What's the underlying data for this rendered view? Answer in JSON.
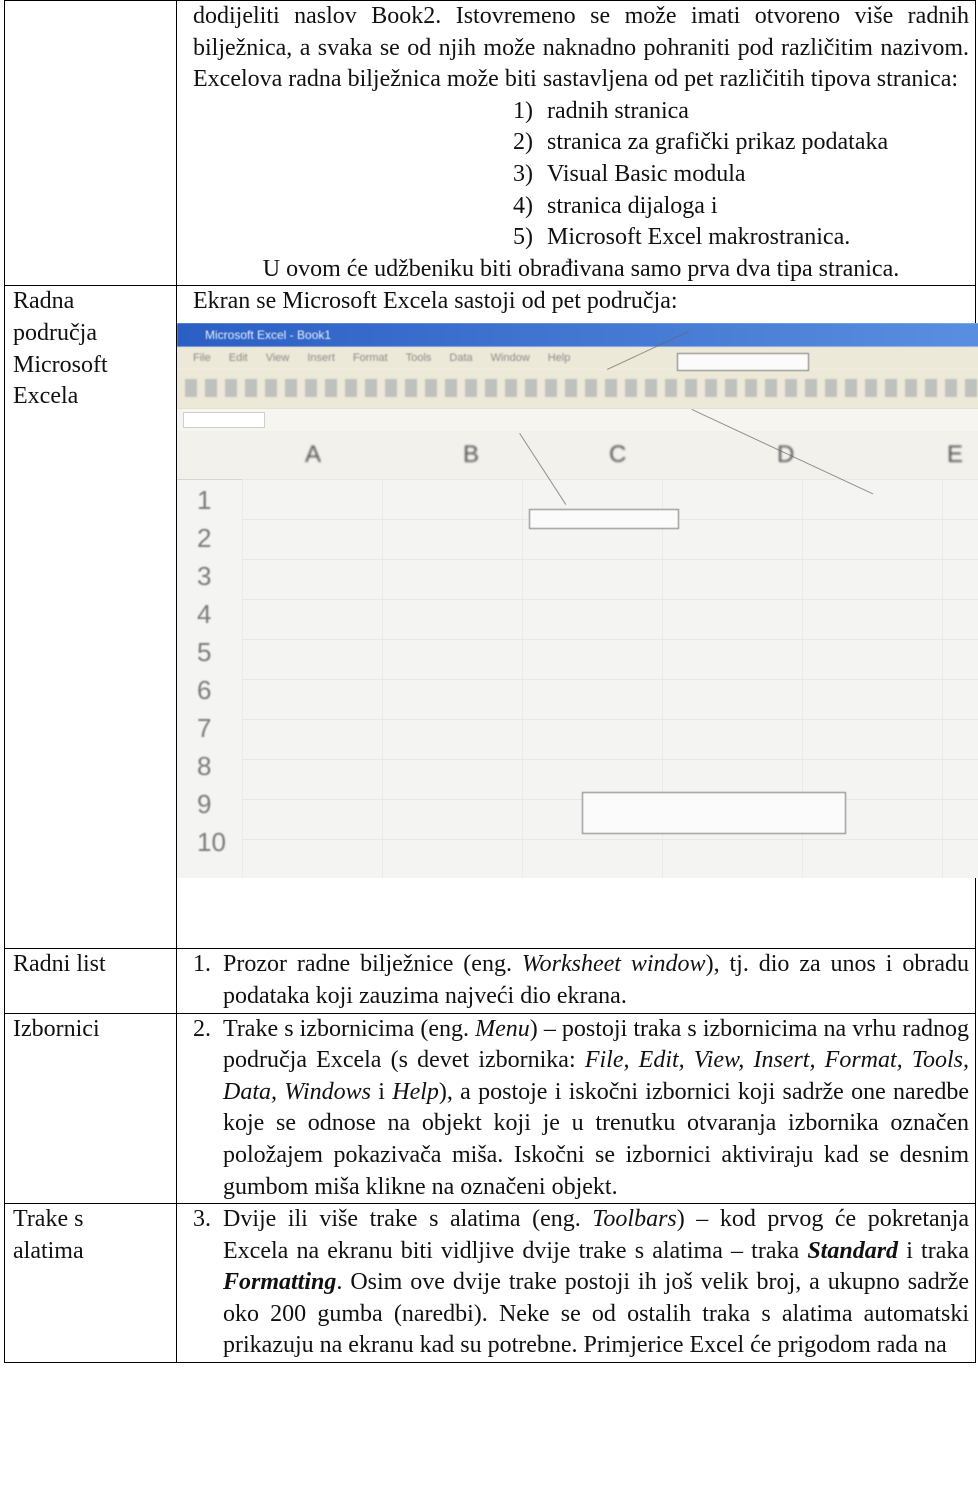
{
  "intro": {
    "paragraph": "dodijeliti naslov Book2. Istovremeno se može imati otvoreno više radnih bilježnica, a svaka se od njih može naknadno pohraniti pod različitim nazivom. Excelova radna bilježnica može biti sastavljena od pet različitih tipova stranica:",
    "list": [
      {
        "num": "1)",
        "text": "radnih stranica"
      },
      {
        "num": "2)",
        "text": "stranica za grafički prikaz podataka"
      },
      {
        "num": "3)",
        "text": "Visual Basic modula"
      },
      {
        "num": "4)",
        "text": "stranica dijaloga i"
      },
      {
        "num": "5)",
        "text": "Microsoft Excel makrostranica."
      }
    ],
    "closing": "U ovom će udžbeniku biti obrađivana samo prva dva tipa stranica."
  },
  "areas": {
    "label": "Radna područja Microsoft Excela",
    "heading": "Ekran se Microsoft Excela sastoji od pet područja:",
    "screenshot": {
      "title": "Microsoft Excel - Book1",
      "menu": [
        "File",
        "Edit",
        "View",
        "Insert",
        "Format",
        "Tools",
        "Data",
        "Window",
        "Help"
      ],
      "columns": [
        "A",
        "B",
        "C",
        "D",
        "E"
      ],
      "rows": [
        "1",
        "2",
        "3",
        "4",
        "5",
        "6",
        "7",
        "8",
        "9",
        "10"
      ]
    }
  },
  "rows": [
    {
      "label": "Radni list",
      "num": "1.",
      "parts": [
        {
          "t": "Prozor radne bilježnice (eng. ",
          "s": ""
        },
        {
          "t": "Worksheet window",
          "s": "i"
        },
        {
          "t": "), tj. dio za unos i obradu podataka  koji zauzima najveći dio ekrana.",
          "s": ""
        }
      ]
    },
    {
      "label": "Izbornici",
      "num": "2.",
      "parts": [
        {
          "t": "Trake s izbornicima (eng. ",
          "s": ""
        },
        {
          "t": "Menu",
          "s": "i"
        },
        {
          "t": ")  – postoji traka s izbornicima na vrhu radnog područja Excela (s devet izbornika: ",
          "s": ""
        },
        {
          "t": "File, Edit, View, Insert, Format, Tools, Data, Windows",
          "s": "i"
        },
        {
          "t": " i ",
          "s": ""
        },
        {
          "t": "Help",
          "s": "i"
        },
        {
          "t": "), a postoje i iskočni izbornici koji sadrže one naredbe koje se odnose na objekt koji je u trenutku otvaranja izbornika označen položajem pokazivača miša. Iskočni se izbornici aktiviraju kad se desnim gumbom miša klikne na označeni objekt.",
          "s": ""
        }
      ]
    },
    {
      "label": "Trake s alatima",
      "num": "3.",
      "parts": [
        {
          "t": "Dvije ili više trake s alatima (eng. ",
          "s": ""
        },
        {
          "t": "Toolbars",
          "s": "i"
        },
        {
          "t": ")  – kod prvog će pokretanja Excela na ekranu biti vidljive dvije trake s alatima  – traka ",
          "s": ""
        },
        {
          "t": "Standard",
          "s": "bi"
        },
        {
          "t": " i traka ",
          "s": ""
        },
        {
          "t": "Formatting",
          "s": "bi"
        },
        {
          "t": ". Osim ove dvije trake postoji ih još velik broj, a ukupno sadrže oko 200 gumba (naredbi). Neke se od ostalih traka s alatima automatski prikazuju na ekranu kad su potrebne. Primjerice Excel će prigodom rada na",
          "s": ""
        }
      ]
    }
  ]
}
